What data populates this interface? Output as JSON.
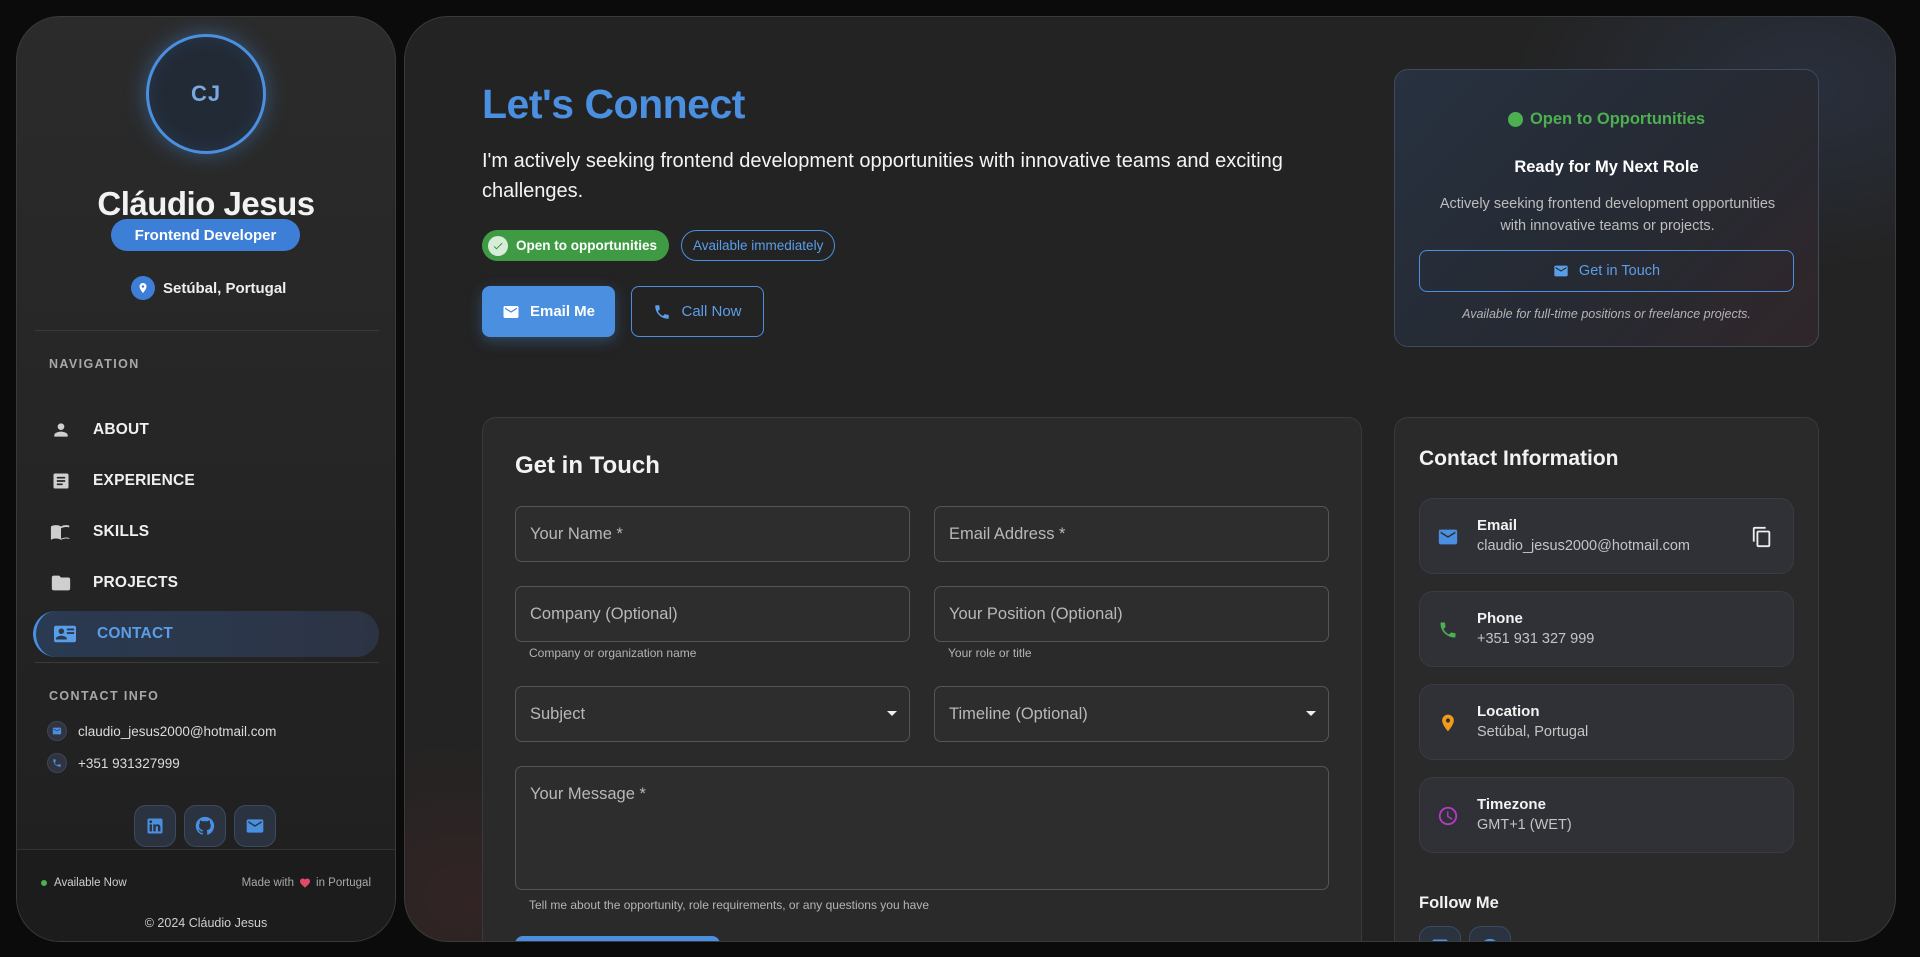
{
  "profile": {
    "initials": "CJ",
    "name": "Cláudio Jesus",
    "role": "Frontend Developer",
    "location": "Setúbal, Portugal"
  },
  "navigation": {
    "label": "NAVIGATION",
    "items": [
      {
        "label": "ABOUT",
        "icon": "person-icon"
      },
      {
        "label": "EXPERIENCE",
        "icon": "article-icon"
      },
      {
        "label": "SKILLS",
        "icon": "book-icon"
      },
      {
        "label": "PROJECTS",
        "icon": "folder-icon"
      },
      {
        "label": "CONTACT",
        "icon": "contact-card-icon",
        "active": true
      }
    ]
  },
  "sidebar_contact": {
    "label": "CONTACT INFO",
    "email": "claudio_jesus2000@hotmail.com",
    "phone": "+351 931327999"
  },
  "socials": [
    "linkedin-icon",
    "github-icon",
    "mail-icon"
  ],
  "sidebar_footer": {
    "available": "Available Now",
    "made_prefix": "Made with",
    "made_suffix": "in Portugal",
    "copyright": "© 2024 Cláudio Jesus"
  },
  "hero": {
    "title": "Let's Connect",
    "subtitle": "I'm actively seeking frontend development opportunities with innovative teams and exciting challenges.",
    "chip_open": "Open to opportunities",
    "chip_available": "Available immediately",
    "email_button": "Email Me",
    "call_button": "Call Now"
  },
  "status_card": {
    "status": "Open to Opportunities",
    "title": "Ready for My Next Role",
    "description": "Actively seeking frontend development opportunities with innovative teams or projects.",
    "button": "Get in Touch",
    "note": "Available for full-time positions or freelance projects."
  },
  "form": {
    "title": "Get in Touch",
    "name_placeholder": "Your Name *",
    "email_placeholder": "Email Address *",
    "company_placeholder": "Company (Optional)",
    "company_helper": "Company or organization name",
    "position_placeholder": "Your Position (Optional)",
    "position_helper": "Your role or title",
    "subject_placeholder": "Subject",
    "timeline_placeholder": "Timeline (Optional)",
    "message_placeholder": "Your Message *",
    "message_helper": "Tell me about the opportunity, role requirements, or any questions you have"
  },
  "contact_info": {
    "title": "Contact Information",
    "items": [
      {
        "label": "Email",
        "value": "claudio_jesus2000@hotmail.com",
        "icon": "mail-icon",
        "color": "#4a8fe0"
      },
      {
        "label": "Phone",
        "value": "+351 931 327 999",
        "icon": "phone-icon",
        "color": "#4caf50"
      },
      {
        "label": "Location",
        "value": "Setúbal, Portugal",
        "icon": "location-pin-icon",
        "color": "#f29a1a"
      },
      {
        "label": "Timezone",
        "value": "GMT+1 (WET)",
        "icon": "clock-icon",
        "color": "#b03ec0"
      }
    ],
    "follow_title": "Follow Me"
  },
  "colors": {
    "accent": "#4a8fe0",
    "success": "#4caf50",
    "background": "#232323"
  }
}
